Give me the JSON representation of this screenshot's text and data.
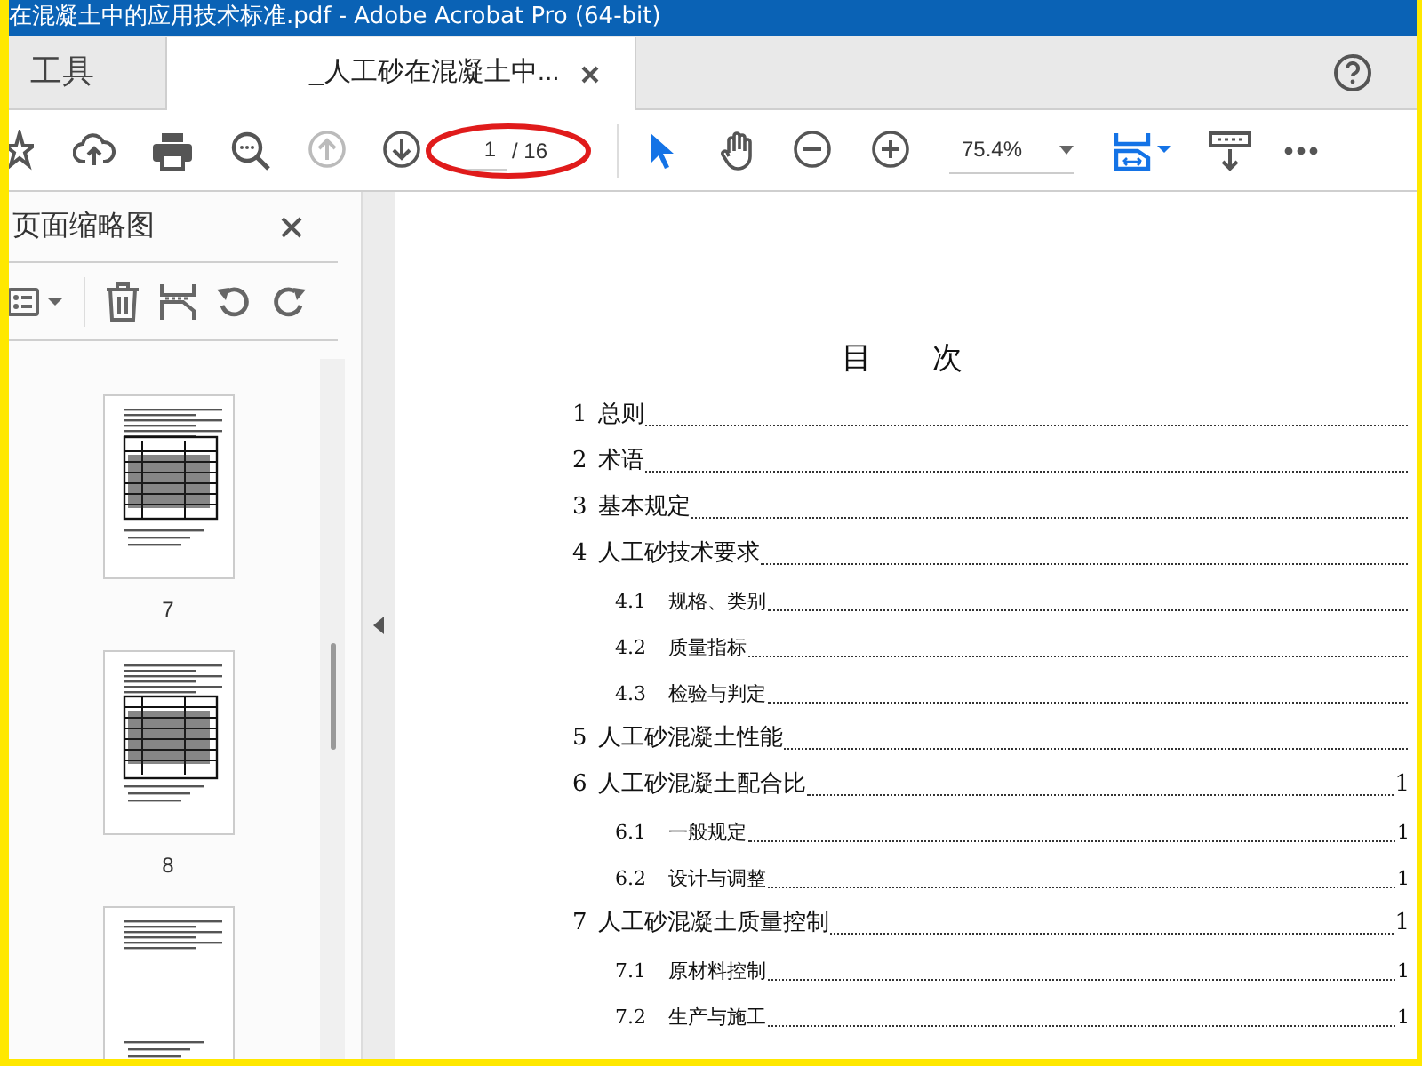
{
  "window": {
    "title": "在混凝土中的应用技术标准.pdf - Adobe Acrobat Pro (64-bit)"
  },
  "tabs": [
    {
      "label": "工具",
      "selected": false,
      "closable": false
    },
    {
      "label": "_人工砂在混凝土中...",
      "selected": true,
      "closable": true
    }
  ],
  "toolbar": {
    "nav": [
      {
        "kind": "prev",
        "disabled": true
      },
      {
        "kind": "next",
        "disabled": false
      }
    ],
    "page_current": "1",
    "page_total": "/ 16",
    "tools": [
      {
        "kind": "select",
        "selected": true
      },
      {
        "kind": "hand",
        "selected": false
      }
    ],
    "zoom": "75.4%"
  },
  "sidebar": {
    "title": "页面缩略图",
    "thumbnails": [
      {
        "label": "7",
        "kind": "table"
      },
      {
        "label": "8",
        "kind": "table"
      },
      {
        "kind": "text"
      }
    ]
  },
  "document": {
    "heading": "目　　次",
    "toc": [
      {
        "num": "1",
        "title": "总则"
      },
      {
        "num": "2",
        "title": "术语"
      },
      {
        "num": "3",
        "title": "基本规定"
      },
      {
        "num": "4",
        "title": "人工砂技术要求",
        "children": [
          {
            "num": "4.1",
            "title": "规格、类别"
          },
          {
            "num": "4.2",
            "title": "质量指标"
          },
          {
            "num": "4.3",
            "title": "检验与判定"
          }
        ]
      },
      {
        "num": "5",
        "title": "人工砂混凝土性能"
      },
      {
        "num": "6",
        "title": "人工砂混凝土配合比",
        "page": "1",
        "children": [
          {
            "num": "6.1",
            "title": "一般规定",
            "page": "1"
          },
          {
            "num": "6.2",
            "title": "设计与调整",
            "page": "1"
          }
        ]
      },
      {
        "num": "7",
        "title": "人工砂混凝土质量控制",
        "page": "1",
        "children": [
          {
            "num": "7.1",
            "title": "原材料控制",
            "page": "1"
          },
          {
            "num": "7.2",
            "title": "生产与施工",
            "page": "1"
          }
        ]
      }
    ]
  }
}
